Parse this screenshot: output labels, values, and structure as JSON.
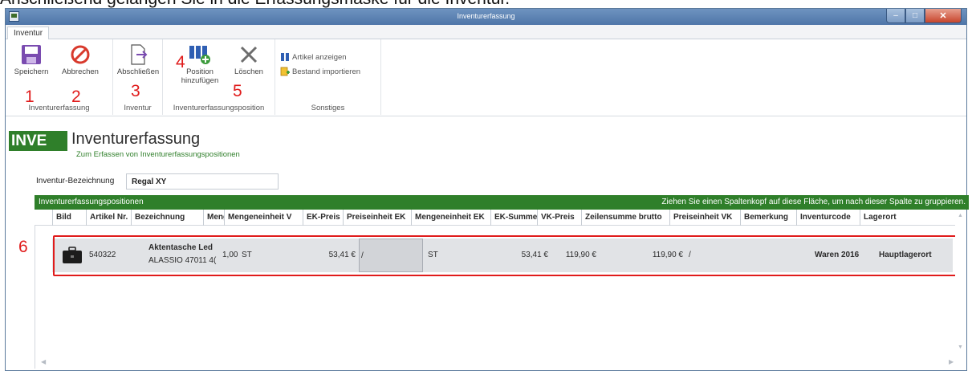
{
  "doc_caption": "Anschließend gelangen Sie in die Erfassungsmaske für die Inventur.",
  "window": {
    "title": "Inventurerfassung"
  },
  "tab": {
    "label": "Inventur"
  },
  "ribbon": {
    "groups": [
      {
        "label": "Inventurerfassung",
        "buttons": [
          {
            "label": "Speichern",
            "icon": "floppy-save-icon"
          },
          {
            "label": "Abbrechen",
            "icon": "cancel-circle-icon"
          }
        ]
      },
      {
        "label": "Inventur",
        "buttons": [
          {
            "label": "Abschließen",
            "icon": "document-arrow-icon"
          }
        ]
      },
      {
        "label": "Inventurerfassungsposition",
        "buttons": [
          {
            "label_line1": "Position",
            "label_line2": "hinzufügen",
            "icon": "add-position-icon"
          },
          {
            "label": "Löschen",
            "icon": "delete-x-icon"
          }
        ]
      },
      {
        "label": "Sonstiges",
        "buttons": [
          {
            "label": "Artikel anzeigen",
            "icon": "article-view-icon"
          },
          {
            "label": "Bestand importieren",
            "icon": "import-icon"
          }
        ]
      }
    ]
  },
  "annotations": [
    "1",
    "2",
    "3",
    "4",
    "5",
    "6"
  ],
  "header": {
    "badge": "INVE",
    "title": "Inventurerfassung",
    "subtitle": "Zum Erfassen von Inventurerfassungspositionen"
  },
  "form": {
    "label": "Inventur-Bezeichnung",
    "value": "Regal XY"
  },
  "grid": {
    "title": "Inventurerfassungspositionen",
    "group_hint": "Ziehen Sie einen Spaltenkopf auf diese Fläche, um nach dieser Spalte zu gruppieren.",
    "columns": [
      "Bild",
      "Artikel Nr.",
      "Bezeichnung",
      "Meng",
      "Mengeneinheit V",
      "EK-Preis",
      "Preiseinheit EK",
      "Mengeneinheit EK",
      "EK-Summe",
      "VK-Preis",
      "Zeilensumme brutto",
      "Preiseinheit VK",
      "Bemerkung",
      "Inventurcode",
      "Lagerort"
    ],
    "rows": [
      {
        "bild_icon": "briefcase-icon",
        "artikel_nr": "540322",
        "bezeichnung_line1": "Aktentasche Led",
        "bezeichnung_line2": "ALASSIO 47011 4(",
        "menge": "1,00",
        "mengeneinheit_vk": "ST",
        "ek_preis": "53,41 €",
        "preiseinheit_ek": "/",
        "mengeneinheit_ek": "ST",
        "ek_summe": "53,41 €",
        "vk_preis": "119,90 €",
        "zeilensumme": "119,90 €",
        "preiseinheit_vk": "/",
        "bemerkung": "",
        "inventurcode": "Waren 2016",
        "lagerort": "Hauptlagerort"
      }
    ]
  },
  "colors": {
    "accent_green": "#2f7f2a",
    "annotation_red": "#e01b1b"
  }
}
